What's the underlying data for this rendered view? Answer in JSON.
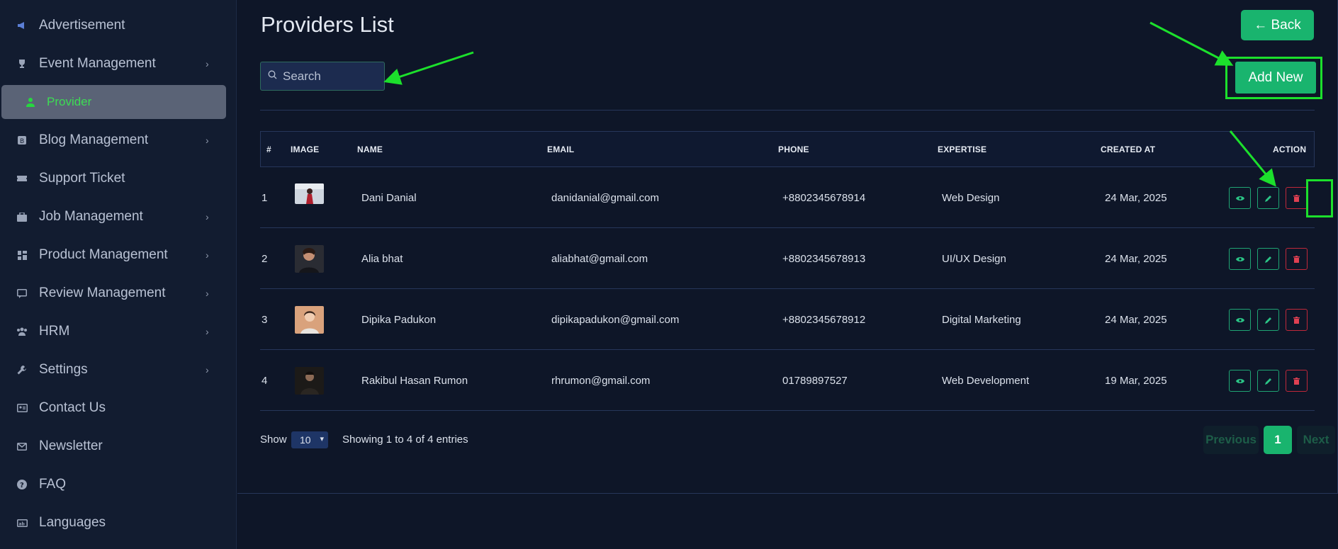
{
  "sidebar": {
    "items": [
      {
        "label": "Advertisement",
        "icon": "megaphone-icon",
        "chevron": false
      },
      {
        "label": "Event Management",
        "icon": "trophy-icon",
        "chevron": true
      },
      {
        "label": "Blog Management",
        "icon": "blog-icon",
        "chevron": true
      },
      {
        "label": "Support Ticket",
        "icon": "ticket-icon",
        "chevron": false
      },
      {
        "label": "Job Management",
        "icon": "briefcase-icon",
        "chevron": true
      },
      {
        "label": "Product Management",
        "icon": "grid-icon",
        "chevron": true
      },
      {
        "label": "Review Management",
        "icon": "review-icon",
        "chevron": true
      },
      {
        "label": "HRM",
        "icon": "users-icon",
        "chevron": true
      },
      {
        "label": "Settings",
        "icon": "wrench-icon",
        "chevron": true
      },
      {
        "label": "Contact Us",
        "icon": "contact-card-icon",
        "chevron": false
      },
      {
        "label": "Newsletter",
        "icon": "mail-icon",
        "chevron": false
      },
      {
        "label": "FAQ",
        "icon": "question-icon",
        "chevron": false
      },
      {
        "label": "Languages",
        "icon": "language-icon",
        "chevron": false
      }
    ],
    "active_sub": {
      "label": "Provider",
      "icon": "user-icon",
      "color": "#3ddc54"
    }
  },
  "header": {
    "title": "Providers List",
    "back_label": "← Back",
    "add_label": "Add New"
  },
  "search": {
    "placeholder": "Search"
  },
  "table": {
    "columns": [
      "#",
      "IMAGE",
      "NAME",
      "EMAIL",
      "PHONE",
      "EXPERTISE",
      "CREATED AT",
      "ACTION"
    ],
    "rows": [
      {
        "no": "1",
        "name": "Dani Danial",
        "email": "danidanial@gmail.com",
        "phone": "+8802345678914",
        "expertise": "Web Design",
        "created": "24 Mar, 2025"
      },
      {
        "no": "2",
        "name": "Alia bhat",
        "email": "aliabhat@gmail.com",
        "phone": "+8802345678913",
        "expertise": "UI/UX Design",
        "created": "24 Mar, 2025"
      },
      {
        "no": "3",
        "name": "Dipika Padukon",
        "email": "dipikapadukon@gmail.com",
        "phone": "+8802345678912",
        "expertise": "Digital Marketing",
        "created": "24 Mar, 2025"
      },
      {
        "no": "4",
        "name": "Rakibul Hasan Rumon",
        "email": "rhrumon@gmail.com",
        "phone": "01789897527",
        "expertise": "Web Development",
        "created": "19 Mar, 2025"
      }
    ]
  },
  "footer": {
    "show_label": "Show",
    "page_size": "10",
    "entries_text": "Showing 1 to 4 of 4 entries",
    "prev_label": "Previous",
    "current_page": "1",
    "next_label": "Next"
  },
  "colors": {
    "accent": "#19b46e",
    "highlight": "#1ce02c",
    "danger": "#e04052",
    "background": "#0e1628"
  }
}
